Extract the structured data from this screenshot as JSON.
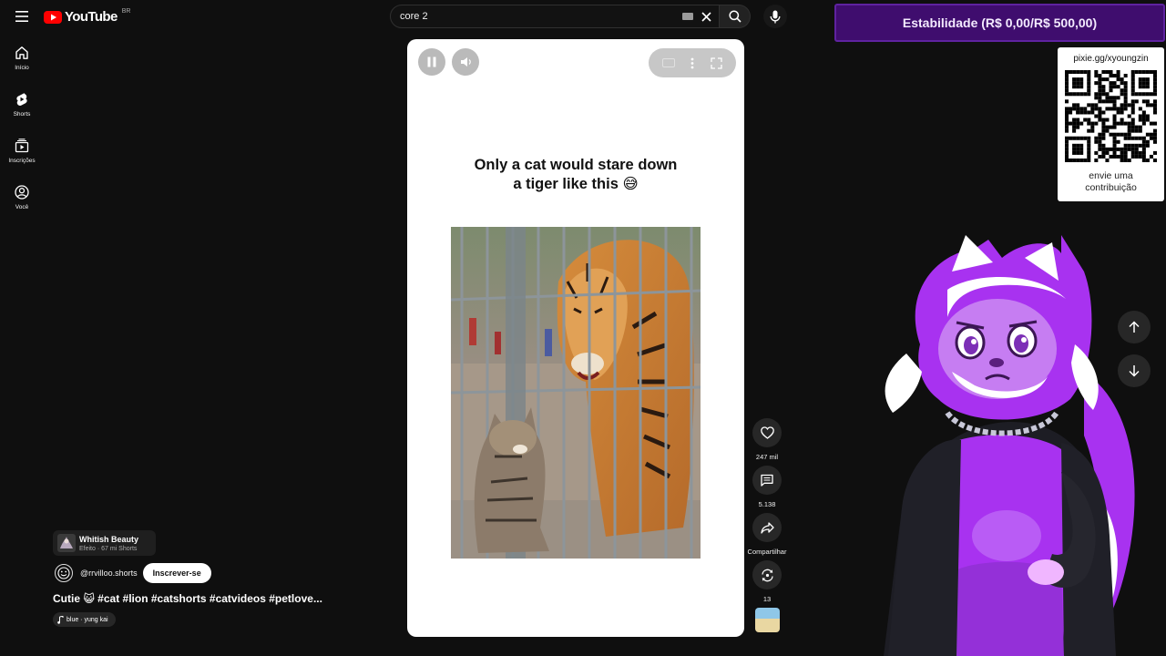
{
  "header": {
    "logo_text": "YouTube",
    "logo_country": "BR",
    "search": {
      "value": "core 2"
    }
  },
  "sidebar": {
    "items": [
      {
        "label": "Início",
        "icon": "home-icon"
      },
      {
        "label": "Shorts",
        "icon": "shorts-icon"
      },
      {
        "label": "Inscrições",
        "icon": "subscriptions-icon"
      },
      {
        "label": "Você",
        "icon": "you-icon"
      }
    ]
  },
  "player": {
    "caption_line1": "Only a cat would stare down",
    "caption_line2": "a tiger like this 😅",
    "state": "playing"
  },
  "actions": {
    "like_count": "247 mil",
    "comment_count": "5.138",
    "share_label": "Compartilhar",
    "remix_count": "13"
  },
  "short": {
    "effect_name": "Whitish Beauty",
    "effect_meta": "Efeito · 67 mi Shorts",
    "channel_handle": "@rrvilloo.shorts",
    "subscribe_label": "Inscrever-se",
    "title": "Cutie 😺 #cat #lion #catshorts #catvideos #petlove...",
    "music": "blue · yung kai"
  },
  "overlay": {
    "goal_text": "Estabilidade (R$ 0,00/R$ 500,00)",
    "goal_progress": 0,
    "qr_url": "pixie.gg/xyoungzin",
    "qr_cta_line1": "envie uma",
    "qr_cta_line2": "contribuição"
  },
  "colors": {
    "background": "#0f0f0f",
    "youtube_red": "#ff0000",
    "goal_purple": "#3f0d6e",
    "mascot_purple": "#a832f0"
  }
}
